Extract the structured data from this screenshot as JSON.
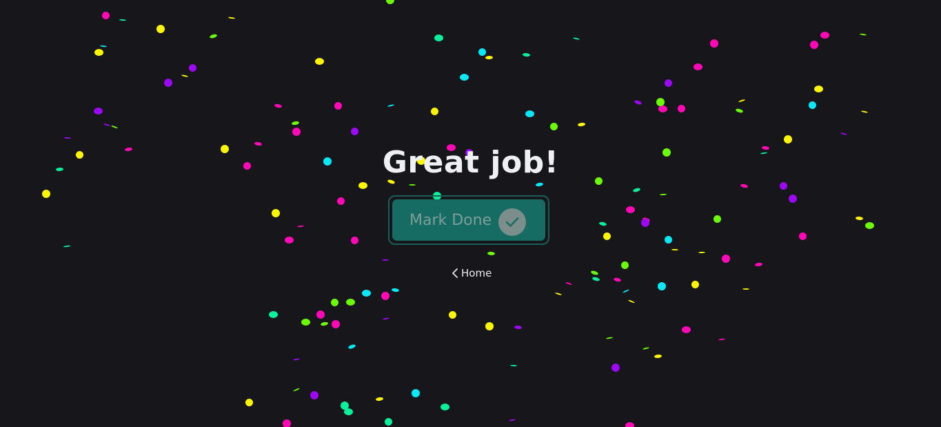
{
  "page": {
    "title": "Great job!",
    "background": "#16161b"
  },
  "done_button": {
    "label": "Mark Done",
    "icon": "checkmark-icon"
  },
  "home_link": {
    "label": "Home",
    "icon": "chevron-left-icon"
  },
  "confetti": {
    "colors": [
      "#ff08b5",
      "#fcf503",
      "#9b08f2",
      "#08e8f7",
      "#6dfa08",
      "#0af09a"
    ]
  }
}
